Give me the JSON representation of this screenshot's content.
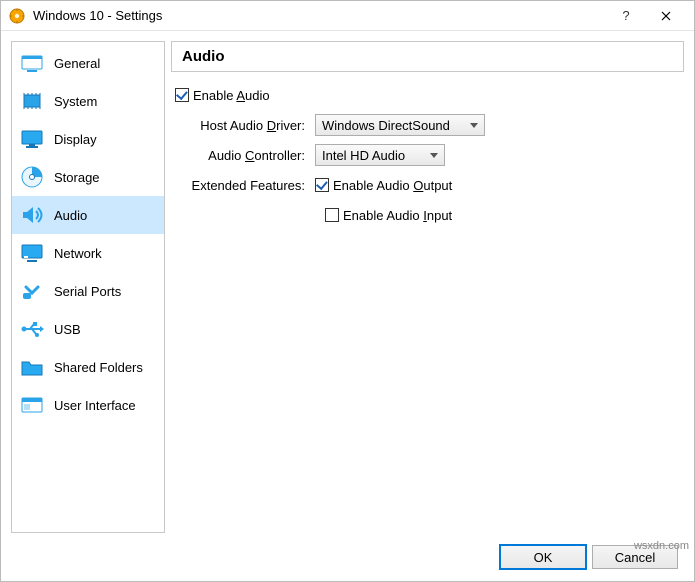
{
  "titlebar": {
    "title": "Windows 10 - Settings"
  },
  "sidebar": {
    "items": [
      {
        "label": "General"
      },
      {
        "label": "System"
      },
      {
        "label": "Display"
      },
      {
        "label": "Storage"
      },
      {
        "label": "Audio"
      },
      {
        "label": "Network"
      },
      {
        "label": "Serial Ports"
      },
      {
        "label": "USB"
      },
      {
        "label": "Shared Folders"
      },
      {
        "label": "User Interface"
      }
    ]
  },
  "section": {
    "title": "Audio"
  },
  "form": {
    "enable_audio": {
      "label": "Enable Audio",
      "checked": true
    },
    "host_driver": {
      "label": "Host Audio Driver:",
      "value": "Windows DirectSound"
    },
    "audio_controller": {
      "label": "Audio Controller:",
      "value": "Intel HD Audio"
    },
    "extended_features_label": "Extended Features:",
    "enable_output": {
      "label": "Enable Audio Output",
      "checked": true
    },
    "enable_input": {
      "label": "Enable Audio Input",
      "checked": false
    }
  },
  "footer": {
    "ok": "OK",
    "cancel": "Cancel"
  },
  "watermark": "wsxdn.com"
}
